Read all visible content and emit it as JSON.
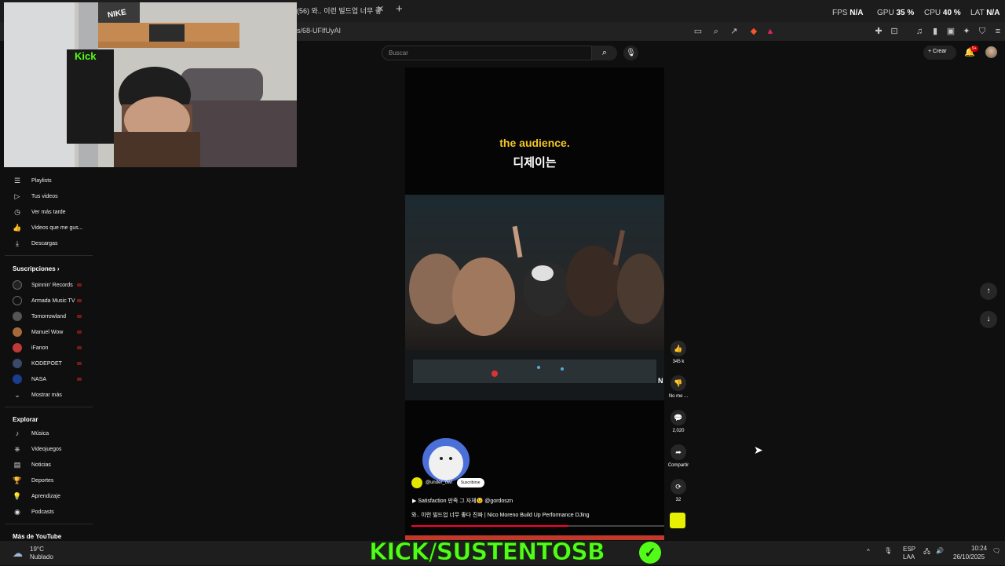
{
  "browser": {
    "tab_title": "(56) 와.. 이런 빌드업 너무 좋",
    "url": "s/68-UFlfUyAI"
  },
  "overlay_stats": [
    {
      "label": "FPS",
      "value": "N/A"
    },
    {
      "label": "GPU",
      "value": "35 %"
    },
    {
      "label": "CPU",
      "value": "40 %"
    },
    {
      "label": "LAT",
      "value": "N/A"
    }
  ],
  "header": {
    "search_placeholder": "Buscar",
    "create_label": "Crear",
    "notif_count": "9+"
  },
  "sidebar": {
    "you_items": [
      {
        "label": "Playlists",
        "icon": "playlist-icon"
      },
      {
        "label": "Tus videos",
        "icon": "video-icon"
      },
      {
        "label": "Ver más tarde",
        "icon": "clock-icon"
      },
      {
        "label": "Videos que me gus...",
        "icon": "thumb-up-icon"
      },
      {
        "label": "Descargas",
        "icon": "download-icon"
      }
    ],
    "subs_title": "Suscripciones",
    "subscriptions": [
      {
        "label": "Spinnin' Records",
        "color": "#222222"
      },
      {
        "label": "Armada Music TV",
        "color": "#111111"
      },
      {
        "label": "Tomorrowland",
        "color": "#555555"
      },
      {
        "label": "Manuel Wow",
        "color": "#a56a3c"
      },
      {
        "label": "iFanon",
        "color": "#c0393b"
      },
      {
        "label": "KODEPOET",
        "color": "#3a4a6a"
      },
      {
        "label": "NASA",
        "color": "#1b3d8f"
      }
    ],
    "show_more": "Mostrar más",
    "explore_title": "Explorar",
    "explore_items": [
      {
        "label": "Música",
        "icon": "music-icon"
      },
      {
        "label": "Videojuegos",
        "icon": "gamepad-icon"
      },
      {
        "label": "Noticias",
        "icon": "news-icon"
      },
      {
        "label": "Deportes",
        "icon": "trophy-icon"
      },
      {
        "label": "Aprendizaje",
        "icon": "bulb-icon"
      },
      {
        "label": "Podcasts",
        "icon": "podcast-icon"
      }
    ],
    "more_title": "Más de YouTube"
  },
  "short": {
    "subtitle_en": "the audience.",
    "subtitle_ko": "디제이는",
    "watermark": "N",
    "channel": "@under_owl",
    "subscribe_label": "Suscribirse",
    "music": "▶ Satisfaction 만족 그 자체😉 @gordoszn",
    "title": "와.. 이런 빌드업 너무 좋다 진짜 | Nico Moreno Build Up Performance DJing",
    "progress": 0.62
  },
  "actions": {
    "likes": "345 k",
    "dislike_label": "No me ...",
    "comments": "2,020",
    "share_label": "Compartir",
    "remix": "32"
  },
  "taskbar": {
    "weather_temp": "19°C",
    "weather_desc": "Nublado",
    "lang_line1": "ESP",
    "lang_line2": "LAA",
    "time": "10:24",
    "date": "26/10/2025",
    "kick_overlay": "KICK/SUSTENTOSB"
  }
}
